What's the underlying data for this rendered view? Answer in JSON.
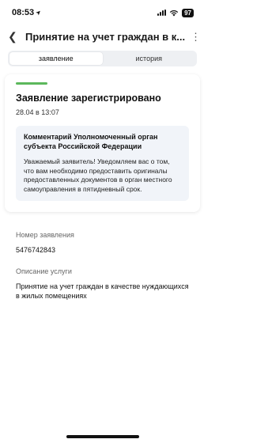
{
  "status_bar": {
    "time": "08:53",
    "location_glyph": "➤",
    "battery": "97"
  },
  "nav": {
    "back_glyph": "❮",
    "title": "Принятие на учет граждан в к...",
    "more_glyph": "⋮"
  },
  "tabs": [
    {
      "label": "заявление",
      "active": true
    },
    {
      "label": "история",
      "active": false
    }
  ],
  "card": {
    "accent_color": "#5cb85c",
    "title": "Заявление зарегистрировано",
    "date": "28.04 в 13:07",
    "comment_title": "Комментарий Уполномоченный орган субъекта Российской Федерации",
    "comment_text": "Уважаемый заявитель! Уведомляем вас о том, что вам необходимо предоставить оригиналы предоставленных документов в орган местного самоуправления в пятидневный срок."
  },
  "details": {
    "number_label": "Номер заявления",
    "number_value": "5476742843",
    "service_label": "Описание услуги",
    "service_value": "Принятие на учет граждан в качестве нуждающихся в жилых помещениях"
  }
}
